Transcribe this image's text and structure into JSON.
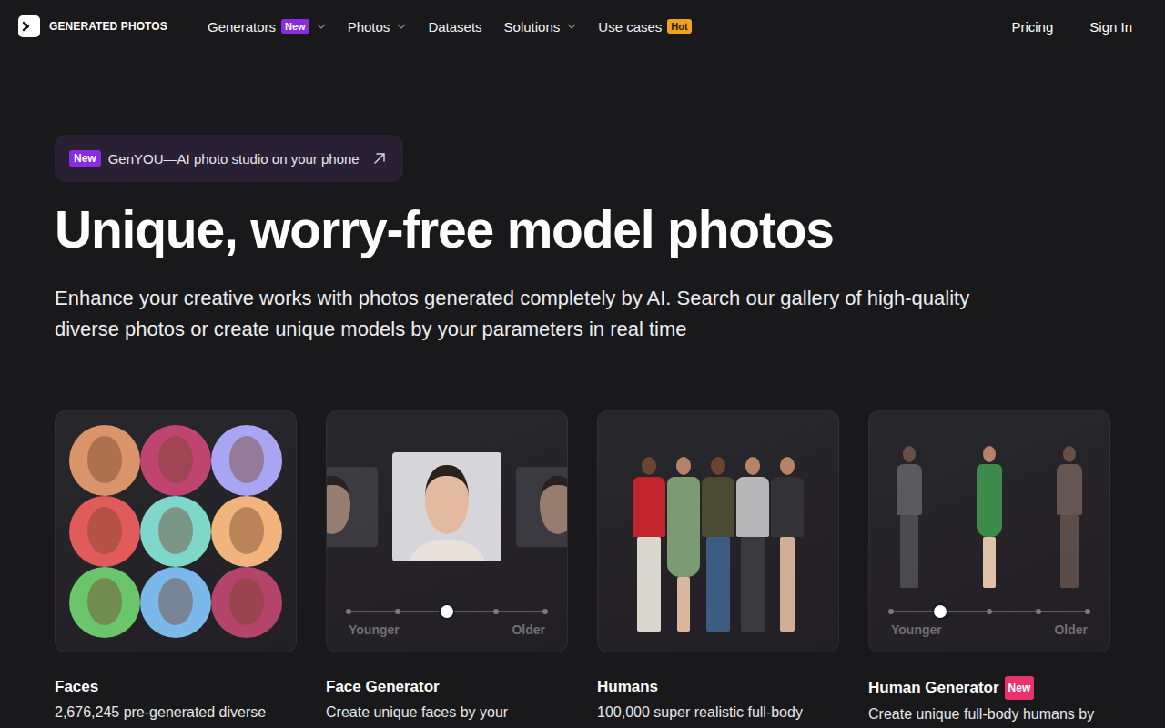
{
  "logo": {
    "text": "GENERATED PHOTOS"
  },
  "nav": {
    "items": [
      {
        "label": "Generators",
        "badge": "New",
        "badge_color": "#8a2be2",
        "dropdown": true
      },
      {
        "label": "Photos",
        "dropdown": true
      },
      {
        "label": "Datasets",
        "dropdown": false
      },
      {
        "label": "Solutions",
        "dropdown": true
      },
      {
        "label": "Use cases",
        "badge": "Hot",
        "badge_color": "#f0a21c",
        "dropdown": false
      }
    ],
    "right": [
      "Pricing",
      "Sign In"
    ]
  },
  "announcement": {
    "badge": "New",
    "text": "GenYOU—AI photo studio on your phone"
  },
  "hero": {
    "title": "Unique, worry-free model photos",
    "subtitle": "Enhance your creative works with photos generated completely by AI. Search our gallery of high-quality diverse photos or create unique models by your parameters in real time"
  },
  "cards": [
    {
      "kind": "faces",
      "title": "Faces",
      "description": "2,676,245 pre-generated diverse"
    },
    {
      "kind": "face-generator",
      "title": "Face Generator",
      "description": "Create unique faces by your",
      "slider": {
        "level": 0.5,
        "min_label": "Younger",
        "max_label": "Older"
      }
    },
    {
      "kind": "humans",
      "title": "Humans",
      "description": "100,000 super realistic full-body"
    },
    {
      "kind": "human-generator",
      "title": "Human Generator",
      "badge": "New",
      "badge_color": "#e8336d",
      "description": "Create unique full-body humans by",
      "slider": {
        "level": 0.25,
        "min_label": "Younger",
        "max_label": "Older"
      }
    }
  ]
}
